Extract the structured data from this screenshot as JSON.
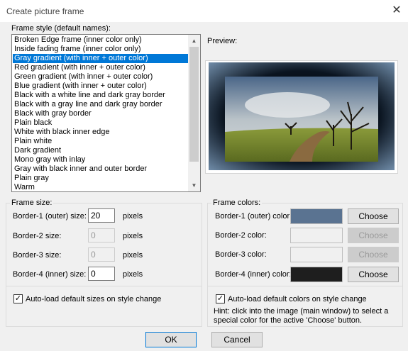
{
  "window": {
    "title": "Create picture frame",
    "close_glyph": "✕"
  },
  "frame_style": {
    "label": "Frame style (default names):",
    "items": [
      "Broken Edge frame (inner color only)",
      "Inside fading frame (inner color only)",
      "Gray gradient (with inner + outer color)",
      "Red gradient (with inner + outer color)",
      "Green gradient (with inner + outer color)",
      "Blue gradient (with inner + outer color)",
      "Black with a white line and dark gray border",
      "Black with a gray line and dark gray border",
      "Black with gray border",
      "Plain black",
      "White with black inner edge",
      "Plain white",
      "Dark gradient",
      "Mono gray with inlay",
      "Gray with black inner and outer border",
      "Plain gray",
      "Warm"
    ],
    "selected_index": 2
  },
  "preview": {
    "label": "Preview:"
  },
  "frame_size": {
    "label": "Frame size:",
    "unit": "pixels",
    "rows": [
      {
        "label": "Border-1 (outer) size:",
        "value": "20",
        "enabled": true
      },
      {
        "label": "Border-2 size:",
        "value": "0",
        "enabled": false
      },
      {
        "label": "Border-3 size:",
        "value": "0",
        "enabled": false
      },
      {
        "label": "Border-4 (inner) size:",
        "value": "0",
        "enabled": true
      }
    ],
    "autoload_label": "Auto-load default sizes on style change",
    "autoload_checked": true
  },
  "frame_colors": {
    "label": "Frame colors:",
    "choose_label": "Choose",
    "rows": [
      {
        "label": "Border-1 (outer) color:",
        "color": "#5a7391",
        "enabled": true
      },
      {
        "label": "Border-2 color:",
        "color": "#f0f0f0",
        "enabled": false
      },
      {
        "label": "Border-3 color:",
        "color": "#f0f0f0",
        "enabled": false
      },
      {
        "label": "Border-4 (inner) color:",
        "color": "#1e1e1e",
        "enabled": true
      }
    ],
    "autoload_label": "Auto-load default colors on style change",
    "autoload_checked": true,
    "hint": "Hint: click into the image (main window) to select a special color for the active 'Choose' button."
  },
  "buttons": {
    "ok": "OK",
    "cancel": "Cancel"
  }
}
